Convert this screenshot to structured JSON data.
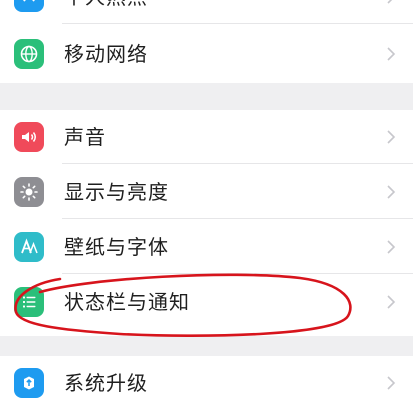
{
  "settings": {
    "items": [
      {
        "label": "个人热点",
        "icon": "hotspot-icon",
        "color": "#1e9bf0"
      },
      {
        "label": "移动网络",
        "icon": "globe-icon",
        "color": "#2bbf7a"
      },
      {
        "label": "声音",
        "icon": "speaker-icon",
        "color": "#f04a5a"
      },
      {
        "label": "显示与亮度",
        "icon": "brightness-icon",
        "color": "#8e8e93"
      },
      {
        "label": "壁纸与字体",
        "icon": "font-icon",
        "color": "#2fbcc9"
      },
      {
        "label": "状态栏与通知",
        "icon": "notification-list-icon",
        "color": "#2bbf7a"
      },
      {
        "label": "系统升级",
        "icon": "system-update-icon",
        "color": "#1e9bf0"
      }
    ]
  },
  "annotation": {
    "shape": "hand-drawn-ellipse",
    "color": "#d7141c",
    "target": "状态栏与通知"
  }
}
